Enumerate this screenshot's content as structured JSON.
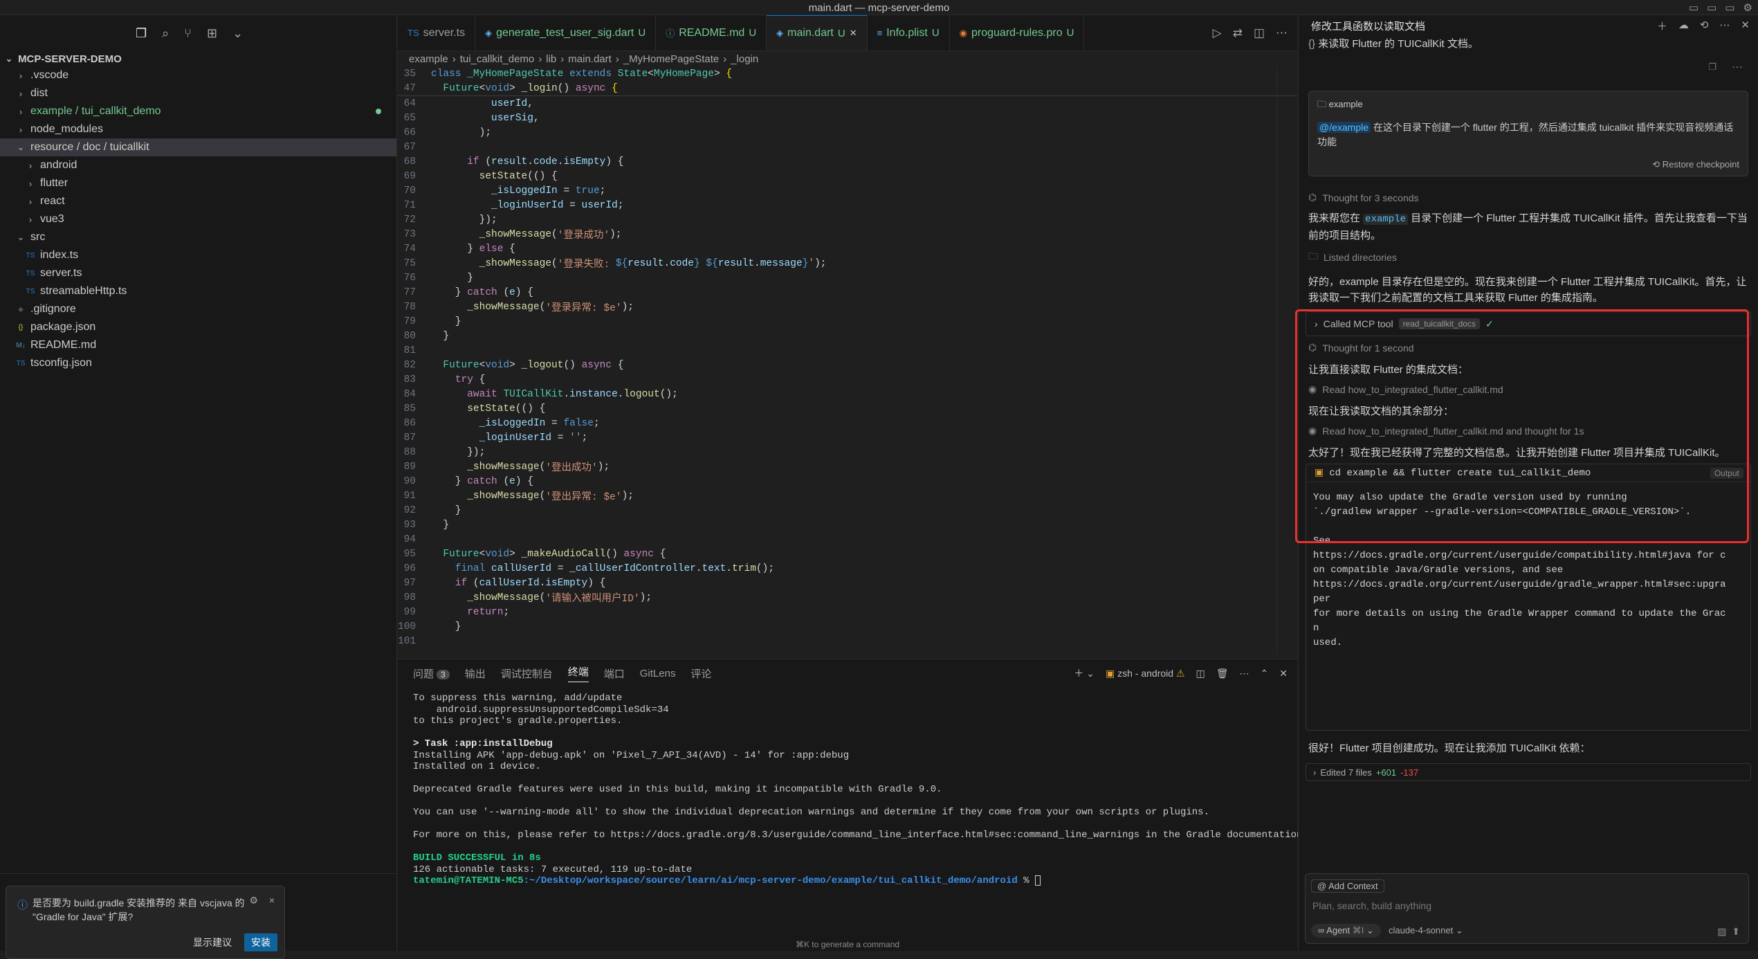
{
  "window": {
    "title": "main.dart — mcp-server-demo"
  },
  "explorer": {
    "root": "MCP-SERVER-DEMO",
    "items": [
      {
        "label": ".vscode",
        "type": "folder",
        "depth": 0,
        "open": false
      },
      {
        "label": "dist",
        "type": "folder",
        "depth": 0,
        "open": false
      },
      {
        "label": "example / tui_callkit_demo",
        "type": "folder",
        "depth": 0,
        "open": false,
        "modified": true
      },
      {
        "label": "node_modules",
        "type": "folder",
        "depth": 0,
        "open": false
      },
      {
        "label": "resource / doc / tuicallkit",
        "type": "folder",
        "depth": 0,
        "open": true,
        "selected": true
      },
      {
        "label": "android",
        "type": "folder",
        "depth": 1,
        "open": false
      },
      {
        "label": "flutter",
        "type": "folder",
        "depth": 1,
        "open": false
      },
      {
        "label": "react",
        "type": "folder",
        "depth": 1,
        "open": false
      },
      {
        "label": "vue3",
        "type": "folder",
        "depth": 1,
        "open": false
      },
      {
        "label": "src",
        "type": "folder",
        "depth": 0,
        "open": true
      },
      {
        "label": "index.ts",
        "type": "ts",
        "depth": 1
      },
      {
        "label": "server.ts",
        "type": "ts",
        "depth": 1
      },
      {
        "label": "streamableHttp.ts",
        "type": "ts",
        "depth": 1
      },
      {
        "label": ".gitignore",
        "type": "git",
        "depth": 0
      },
      {
        "label": "package.json",
        "type": "json",
        "depth": 0
      },
      {
        "label": "README.md",
        "type": "md",
        "depth": 0
      },
      {
        "label": "tsconfig.json",
        "type": "tsconfig",
        "depth": 0
      }
    ]
  },
  "notification": {
    "message": "是否要为 build.gradle 安装推荐的 来自 vscjava 的 \"Gradle for Java\" 扩展?",
    "secondary": "显示建议",
    "primary": "安装"
  },
  "tabs": [
    {
      "label": "server.ts",
      "badge": "",
      "icon": "TS"
    },
    {
      "label": "generate_test_user_sig.dart",
      "badge": "U",
      "icon": "◈"
    },
    {
      "label": "README.md",
      "badge": "U",
      "icon": "ⓘ"
    },
    {
      "label": "main.dart",
      "badge": "U",
      "icon": "◈",
      "active": true
    },
    {
      "label": "Info.plist",
      "badge": "U",
      "icon": "≡"
    },
    {
      "label": "proguard-rules.pro",
      "badge": "U",
      "icon": "◉"
    }
  ],
  "breadcrumb": [
    "example",
    "tui_callkit_demo",
    "lib",
    "main.dart",
    "_MyHomePageState",
    "_login"
  ],
  "terminal": {
    "tabs": [
      "问题",
      "输出",
      "调试控制台",
      "终端",
      "端口",
      "GitLens",
      "评论"
    ],
    "problems_count": "3",
    "active": "终端",
    "shell_label": "zsh - android",
    "lines": [
      "To suppress this warning, add/update",
      "    android.suppressUnsupportedCompileSdk=34",
      "to this project's gradle.properties.",
      "",
      "> Task :app:installDebug",
      "Installing APK 'app-debug.apk' on 'Pixel_7_API_34(AVD) - 14' for :app:debug",
      "Installed on 1 device.",
      "",
      "Deprecated Gradle features were used in this build, making it incompatible with Gradle 9.0.",
      "",
      "You can use '--warning-mode all' to show the individual deprecation warnings and determine if they come from your own scripts or plugins.",
      "",
      "For more on this, please refer to https://docs.gradle.org/8.3/userguide/command_line_interface.html#sec:command_line_warnings in the Gradle documentation.",
      "",
      "BUILD SUCCESSFUL in 8s",
      "126 actionable tasks: 7 executed, 119 up-to-date"
    ],
    "prompt_user": "tatemin@TATEMIN-MC5",
    "prompt_path": ":~/Desktop/workspace/source/learn/ai/mcp-server-demo/example/tui_callkit_demo/android",
    "prompt_char": "%"
  },
  "hint": "⌘K to generate a command",
  "chat": {
    "title": "修改工具函数以读取文档",
    "top_text": "来读取 Flutter 的 TUICallKit 文档。",
    "user": {
      "folder": "example",
      "mention": "@/example",
      "message": " 在这个目录下创建一个 flutter 的工程，然后通过集成 tuicallkit 插件来实现音视频通话功能",
      "restore": "Restore checkpoint"
    },
    "thought1": "Thought for 3 seconds",
    "reply1_a": "我来帮您在 ",
    "reply1_code": "example",
    "reply1_b": " 目录下创建一个 Flutter 工程并集成 TUICallKit 插件。首先让我查看一下当前的项目结构。",
    "listed": "Listed directories",
    "reply2": "好的，example 目录存在但是空的。现在我来创建一个 Flutter 工程并集成 TUICallKit。首先，让我读取一下我们之前配置的文档工具来获取 Flutter 的集成指南。",
    "tool_label": "Called MCP tool",
    "tool_chip": "read_tuicallkit_docs",
    "thought2": "Thought for 1 second",
    "reply3": "让我直接读取 Flutter 的集成文档：",
    "read1": "Read how_to_integrated_flutter_callkit.md",
    "reply4": "现在让我读取文档的其余部分：",
    "read2": "Read how_to_integrated_flutter_callkit.md and thought for 1s",
    "reply5": "太好了！现在我已经获得了完整的文档信息。让我开始创建 Flutter 项目并集成 TUICallKit。",
    "cmd": "cd example && flutter create tui_callkit_demo",
    "cmd_tag": "Output",
    "output": "You may also update the Gradle version used by running\n`./gradlew wrapper --gradle-version=<COMPATIBLE_GRADLE_VERSION>`.\n\nSee\nhttps://docs.gradle.org/current/userguide/compatibility.html#java for c\non compatible Java/Gradle versions, and see\nhttps://docs.gradle.org/current/userguide/gradle_wrapper.html#sec:upgra\nper\nfor more details on using the Gradle Wrapper command to update the Grac\nn\nused.",
    "reply6": "很好！Flutter 项目创建成功。现在让我添加 TUICallKit 依赖：",
    "edited": "Edited 7 files",
    "added": "+601",
    "removed": "-137",
    "add_context": "Add Context",
    "placeholder": "Plan, search, build anything",
    "mode": "Agent",
    "mode_key": "⌘I",
    "model": "claude-4-sonnet"
  },
  "colors": {
    "accent": "#0078d4",
    "highlight_border": "#e8312f",
    "untracked": "#73c991"
  }
}
